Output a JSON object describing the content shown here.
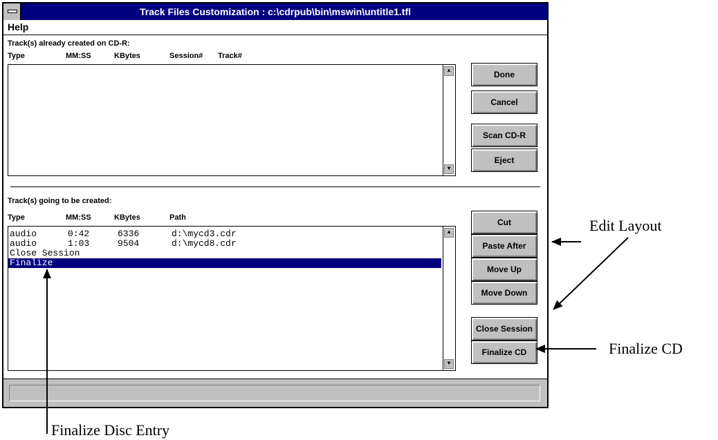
{
  "window": {
    "title": "Track Files Customization : c:\\cdrpub\\bin\\mswin\\untitle1.tfl"
  },
  "menu": {
    "help": "Help"
  },
  "created": {
    "heading": "Track(s) already created on CD-R:",
    "columns": [
      "Type",
      "MM:SS",
      "KBytes",
      "Session#",
      "Track#"
    ],
    "rows": []
  },
  "pending": {
    "heading": "Track(s) going to be created:",
    "columns": [
      "Type",
      "MM:SS",
      "KBytes",
      "Path"
    ],
    "rows": [
      {
        "type": "audio",
        "time": "0:42",
        "kbytes": "6336",
        "path": "d:\\mycd3.cdr"
      },
      {
        "type": "audio",
        "time": "1:03",
        "kbytes": "9504",
        "path": "d:\\mycd8.cdr"
      },
      {
        "type": "Close Session",
        "time": "",
        "kbytes": "",
        "path": ""
      },
      {
        "type": "Finalize",
        "time": "",
        "kbytes": "",
        "path": ""
      }
    ],
    "selected_index": 3
  },
  "buttons": {
    "done": "Done",
    "cancel": "Cancel",
    "scan": "Scan CD-R",
    "eject": "Eject",
    "cut": "Cut",
    "paste_after": "Paste After",
    "move_up": "Move Up",
    "move_down": "Move Down",
    "close_session": "Close Session",
    "finalize_cd": "Finalize CD"
  },
  "icons": {
    "system_menu": "system-menu-icon",
    "scroll_up": "scroll-up-arrow-icon",
    "scroll_down": "scroll-down-arrow-icon"
  },
  "annotations": {
    "edit_layout": "Edit Layout",
    "finalize_cd": "Finalize CD",
    "finalize_disc_entry": "Finalize Disc Entry"
  }
}
